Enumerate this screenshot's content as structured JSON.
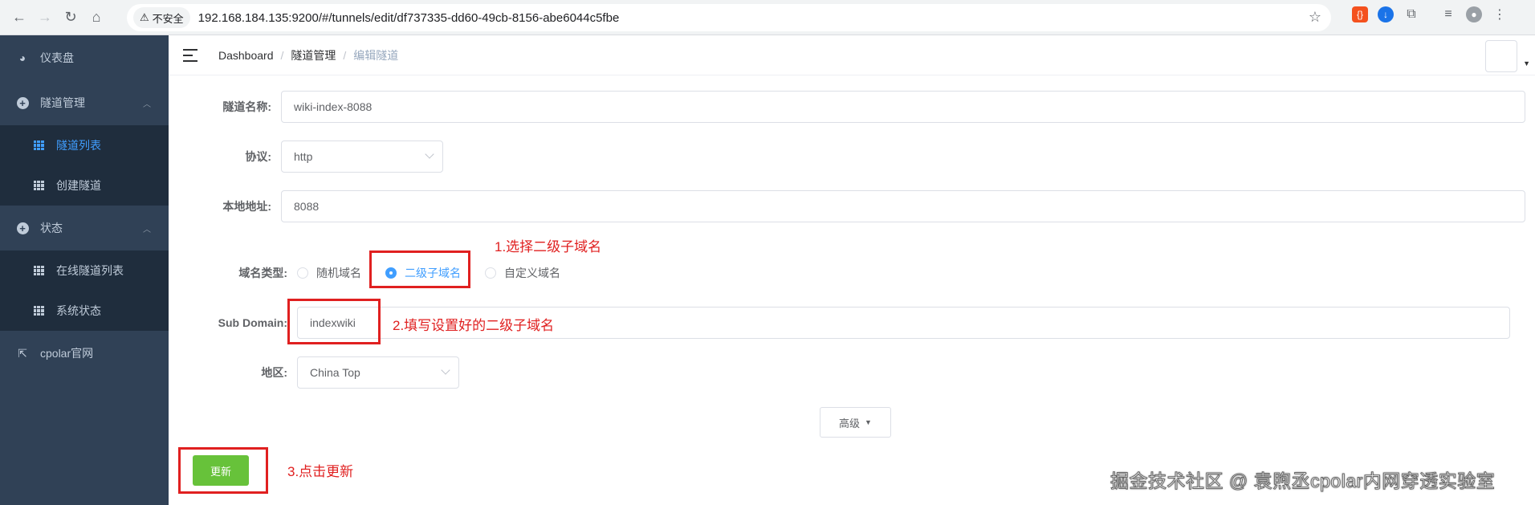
{
  "browser": {
    "security_label": "不安全",
    "url": "192.168.184.135:9200/#/tunnels/edit/df737335-dd60-49cb-8156-abe6044c5fbe"
  },
  "sidebar": {
    "items": [
      {
        "label": "仪表盘",
        "icon": "dashboard-icon"
      },
      {
        "label": "隧道管理",
        "icon": "plus-circle-icon",
        "expanded": true,
        "children": [
          {
            "label": "隧道列表",
            "icon": "grid-icon",
            "active": true
          },
          {
            "label": "创建隧道",
            "icon": "grid-icon"
          }
        ]
      },
      {
        "label": "状态",
        "icon": "plus-circle-icon",
        "expanded": true,
        "children": [
          {
            "label": "在线隧道列表",
            "icon": "grid-icon"
          },
          {
            "label": "系统状态",
            "icon": "grid-icon"
          }
        ]
      },
      {
        "label": "cpolar官网",
        "icon": "external-link-icon"
      }
    ]
  },
  "breadcrumb": [
    "Dashboard",
    "隧道管理",
    "编辑隧道"
  ],
  "form": {
    "tunnel_name": {
      "label": "隧道名称:",
      "value": "wiki-index-8088"
    },
    "protocol": {
      "label": "协议:",
      "value": "http"
    },
    "local_address": {
      "label": "本地地址:",
      "value": "8088"
    },
    "domain_type": {
      "label": "域名类型:",
      "options": [
        "随机域名",
        "二级子域名",
        "自定义域名"
      ],
      "selected": "二级子域名"
    },
    "sub_domain": {
      "label": "Sub Domain:",
      "value": "indexwiki"
    },
    "region": {
      "label": "地区:",
      "value": "China Top"
    },
    "advanced_label": "高级",
    "update_label": "更新"
  },
  "annotations": {
    "step1": "1.选择二级子域名",
    "step2": "2.填写设置好的二级子域名",
    "step3": "3.点击更新"
  },
  "watermark": "掘金技术社区 @ 袁煦丞cpolar内网穿透实验室",
  "colors": {
    "sidebar_bg": "#304156",
    "submenu_bg": "#1f2d3d",
    "active": "#409eff",
    "update_btn": "#67c23a",
    "annotation": "#e02020"
  }
}
